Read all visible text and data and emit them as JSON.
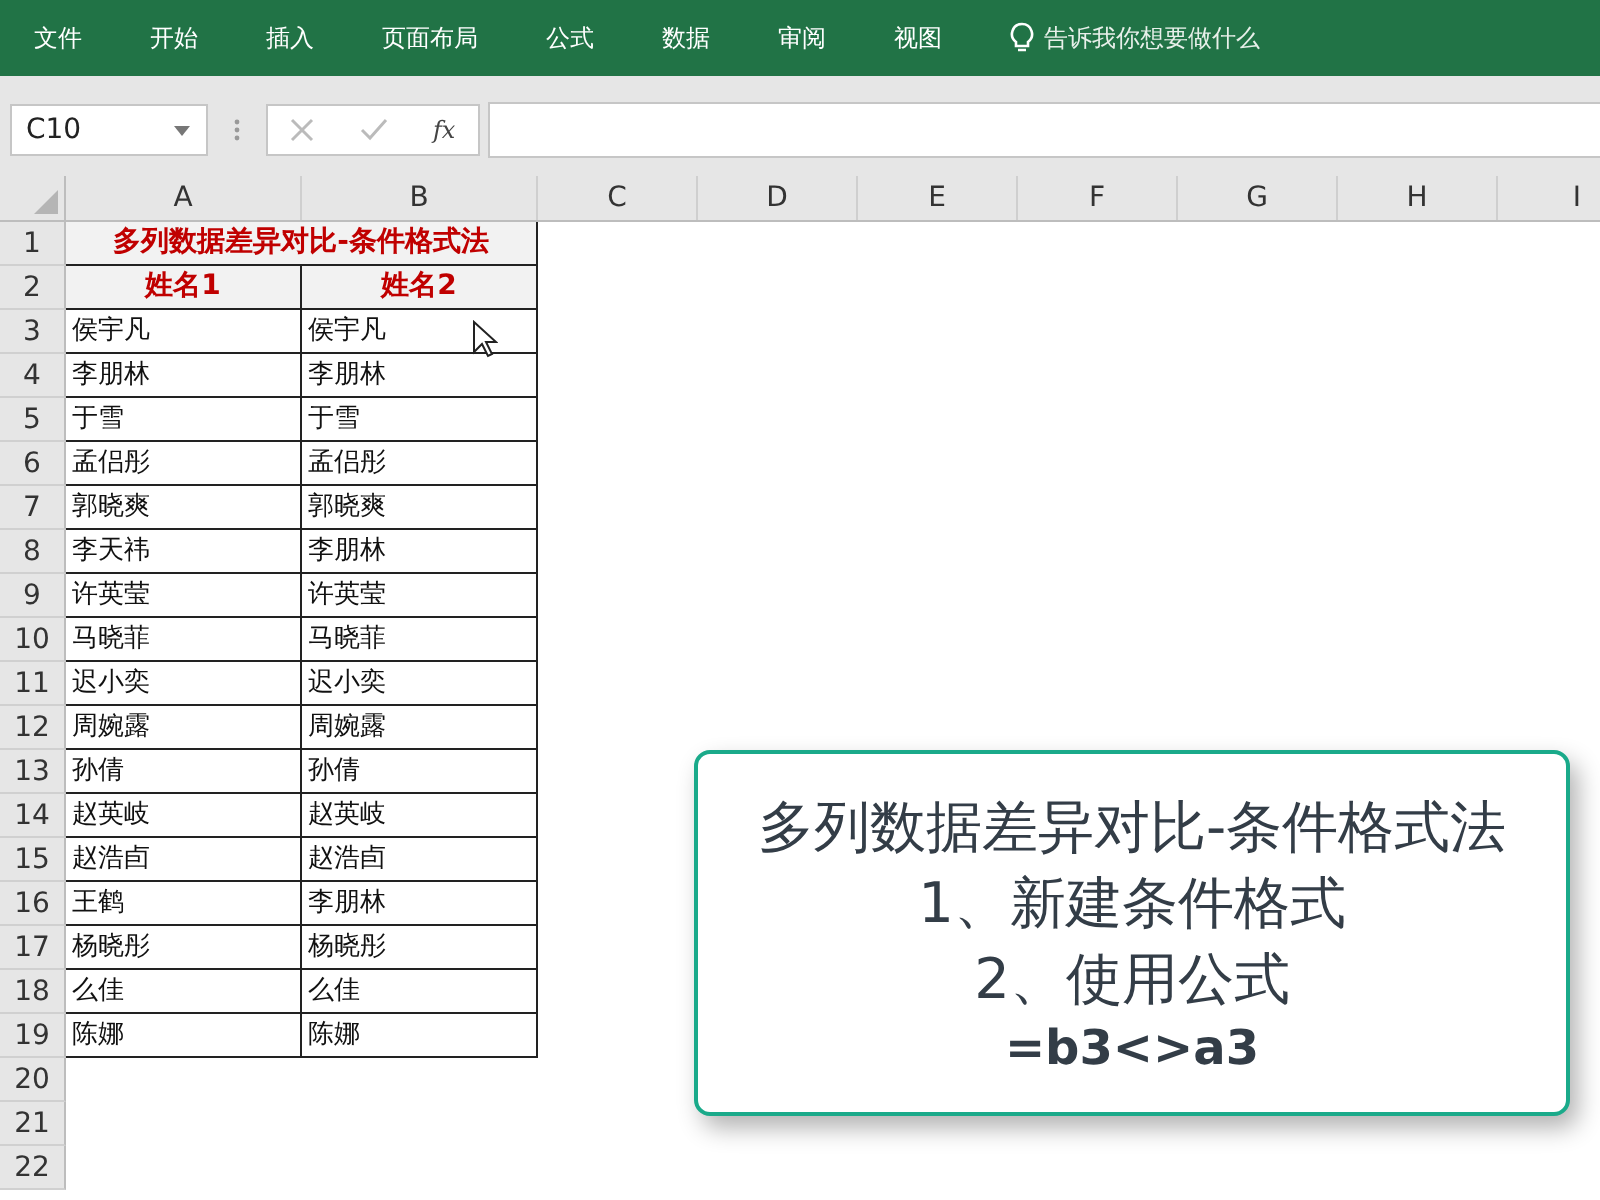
{
  "ribbon_tabs": [
    {
      "label": "文件"
    },
    {
      "label": "开始"
    },
    {
      "label": "插入"
    },
    {
      "label": "页面布局"
    },
    {
      "label": "公式"
    },
    {
      "label": "数据"
    },
    {
      "label": "审阅"
    },
    {
      "label": "视图"
    }
  ],
  "tell_me": {
    "placeholder": "告诉我你想要做什么"
  },
  "name_box": {
    "value": "C10"
  },
  "formula_bar": {
    "function_label": "fx"
  },
  "columns": [
    "A",
    "B",
    "C",
    "D",
    "E",
    "F",
    "G",
    "H",
    "I"
  ],
  "rows": [
    {
      "number": "1",
      "kind": "title",
      "cells": [
        "多列数据差异对比-条件格式法"
      ]
    },
    {
      "number": "2",
      "kind": "header",
      "cells": [
        "姓名1",
        "姓名2"
      ]
    },
    {
      "number": "3",
      "kind": "data",
      "cells": [
        "侯宇凡",
        "侯宇凡"
      ]
    },
    {
      "number": "4",
      "kind": "data",
      "cells": [
        "李朋林",
        "李朋林"
      ]
    },
    {
      "number": "5",
      "kind": "data",
      "cells": [
        "于雪",
        "于雪"
      ]
    },
    {
      "number": "6",
      "kind": "data",
      "cells": [
        "孟侣彤",
        "孟侣彤"
      ]
    },
    {
      "number": "7",
      "kind": "data",
      "cells": [
        "郭晓爽",
        "郭晓爽"
      ]
    },
    {
      "number": "8",
      "kind": "data",
      "cells": [
        "李天祎",
        "李朋林"
      ]
    },
    {
      "number": "9",
      "kind": "data",
      "cells": [
        "许英莹",
        "许英莹"
      ]
    },
    {
      "number": "10",
      "kind": "data",
      "cells": [
        "马晓菲",
        "马晓菲"
      ]
    },
    {
      "number": "11",
      "kind": "data",
      "cells": [
        "迟小奕",
        "迟小奕"
      ]
    },
    {
      "number": "12",
      "kind": "data",
      "cells": [
        "周婉露",
        "周婉露"
      ]
    },
    {
      "number": "13",
      "kind": "data",
      "cells": [
        "孙倩",
        "孙倩"
      ]
    },
    {
      "number": "14",
      "kind": "data",
      "cells": [
        "赵英岐",
        "赵英岐"
      ]
    },
    {
      "number": "15",
      "kind": "data",
      "cells": [
        "赵浩卣",
        "赵浩卣"
      ]
    },
    {
      "number": "16",
      "kind": "data",
      "cells": [
        "王鹤",
        "李朋林"
      ]
    },
    {
      "number": "17",
      "kind": "data",
      "cells": [
        "杨晓彤",
        "杨晓彤"
      ]
    },
    {
      "number": "18",
      "kind": "data",
      "cells": [
        "么佳",
        "么佳"
      ]
    },
    {
      "number": "19",
      "kind": "data",
      "cells": [
        "陈娜",
        "陈娜"
      ]
    },
    {
      "number": "20",
      "kind": "empty"
    },
    {
      "number": "21",
      "kind": "empty"
    },
    {
      "number": "22",
      "kind": "empty"
    }
  ],
  "note": {
    "lines": [
      "多列数据差异对比-条件格式法",
      "1、新建条件格式",
      "2、使用公式"
    ],
    "formula": "=b3<>a3"
  }
}
